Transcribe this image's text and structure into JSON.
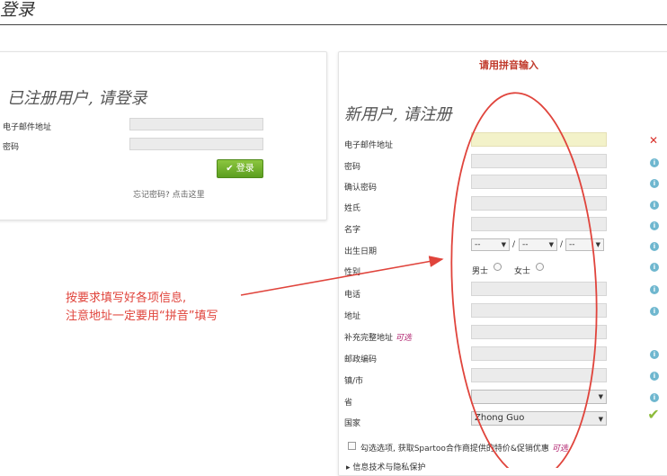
{
  "page": {
    "title": "登录"
  },
  "login": {
    "heading": "已注册用户, 请登录",
    "email_label": "电子邮件地址",
    "password_label": "密码",
    "button_label": "登录",
    "forgot_text": "忘记密码? 点击这里"
  },
  "register": {
    "hint": "请用拼音输入",
    "heading": "新用户, 请注册",
    "fields": {
      "email": "电子邮件地址",
      "password": "密码",
      "confirm_password": "确认密码",
      "surname": "姓氏",
      "given_name": "名字",
      "birthdate": "出生日期",
      "gender": "性别",
      "phone": "电话",
      "address": "地址",
      "address_extra": "补充完整地址",
      "postcode": "邮政编码",
      "city": "镇/市",
      "province": "省",
      "country": "国家"
    },
    "optional_label": "可选",
    "birth_placeholder": "--",
    "birth_separator": "/",
    "gender_male": "男士",
    "gender_female": "女士",
    "country_value": "Zhong Guo",
    "newsletter_text": "勾选选项, 获取Spartoo合作商提供的特价&促销优惠",
    "privacy_text": "▸ 信息技术与隐私保护"
  },
  "annotation": {
    "line1": "按要求填写好各项信息,",
    "line2": "注意地址一定要用“拼音”填写"
  },
  "colors": {
    "accent_red": "#e0443c",
    "button_green": "#6aab27",
    "info_blue": "#6fb7cf",
    "error_red": "#d9302a"
  }
}
